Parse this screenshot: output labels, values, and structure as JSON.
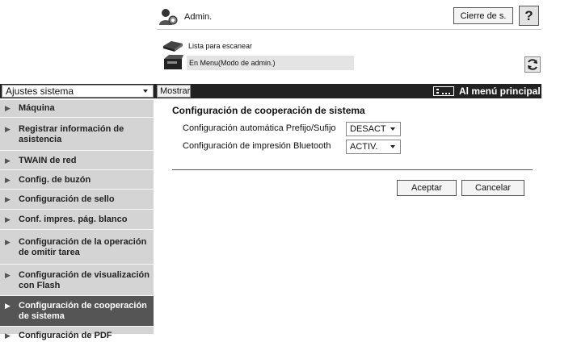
{
  "header": {
    "user": "Admin.",
    "logout_label": "Cierre de s.",
    "help_label": "?",
    "scan_list": "Lista para escanear",
    "admin_mode": "En Menu(Modo de admin.)"
  },
  "menubar": {
    "category_select": "Ajustes sistema",
    "show_label": "Mostrar",
    "main_menu_label": "Al menú principal"
  },
  "sidebar": {
    "items": [
      {
        "label": "Máquina"
      },
      {
        "label": "Registrar información de asistencia"
      },
      {
        "label": "TWAIN de red"
      },
      {
        "label": "Config. de buzón"
      },
      {
        "label": "Configuración de sello"
      },
      {
        "label": "Conf. impres. pág. blanco"
      },
      {
        "label": "Configuración de la operación de omitir tarea"
      },
      {
        "label": "Configuración de visualización con Flash"
      },
      {
        "label": "Configuración de cooperación de sistema",
        "active": true
      },
      {
        "label": "Configuración de PDF"
      }
    ]
  },
  "main": {
    "title": "Configuración de cooperación de sistema",
    "settings": [
      {
        "label": "Configuración automática Prefijo/Sufijo",
        "value": "DESACT"
      },
      {
        "label": "Configuración de impresión Bluetooth",
        "value": "ACTIV."
      }
    ],
    "ok_label": "Aceptar",
    "cancel_label": "Cancelar"
  },
  "colors": {
    "menubar_bg": "#222222",
    "sidebar_bg": "#d4d4d4",
    "sidebar_active_bg": "#555555"
  }
}
